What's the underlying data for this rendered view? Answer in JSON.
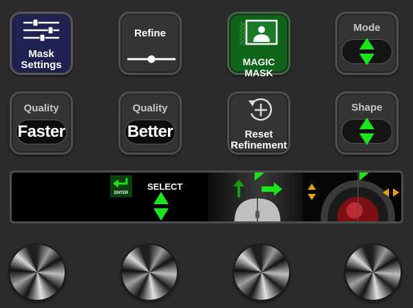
{
  "keys": {
    "mask_settings": "Mask\nSettings",
    "mask_settings_line1": "Mask",
    "mask_settings_line2": "Settings",
    "refine": "Refine",
    "magic_mask": "MAGIC MASK",
    "mode": "Mode",
    "quality1_title": "Quality",
    "quality1_value": "Faster",
    "quality2_title": "Quality",
    "quality2_value": "Better",
    "reset_line1": "Reset",
    "reset_line2": "Refinement",
    "shape": "Shape"
  },
  "display": {
    "enter_label": "ENTER",
    "select_label": "SELECT"
  },
  "refine_level": 0.5,
  "colors": {
    "accent_green": "#19e619",
    "mask_key_bg": "#1f2255",
    "magic_key_bg": "#0f6a18",
    "arrow_orange": "#e6a200"
  },
  "icons": [
    "sliders-icon",
    "slider-icon",
    "person-mask-icon",
    "updown-arrows-icon",
    "reset-plus-icon",
    "enter-icon",
    "arrow-up-icon",
    "arrow-right-icon",
    "mouse-icon",
    "trackball-icon"
  ]
}
